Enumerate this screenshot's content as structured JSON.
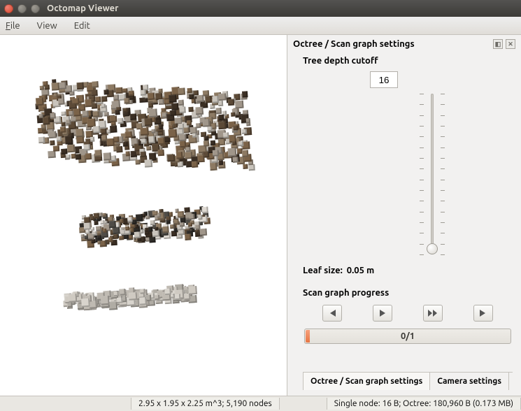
{
  "window": {
    "title": "Octomap Viewer"
  },
  "menu": {
    "file": "File",
    "view": "View",
    "edit": "Edit"
  },
  "panel": {
    "header": "Octree / Scan graph settings",
    "depth_label": "Tree depth cutoff",
    "depth_value": "16",
    "leaf_label": "Leaf size:",
    "leaf_value": "0.05 m",
    "scan_label": "Scan graph progress",
    "progress_text": "0/1"
  },
  "tabs": {
    "octree": "Octree / Scan graph settings",
    "camera": "Camera settings"
  },
  "status": {
    "left": "2.95 x 1.95 x 2.25 m^3; 5,190 nodes",
    "right": "Single node: 16 B; Octree: 180,960 B (0.173 MB)"
  }
}
